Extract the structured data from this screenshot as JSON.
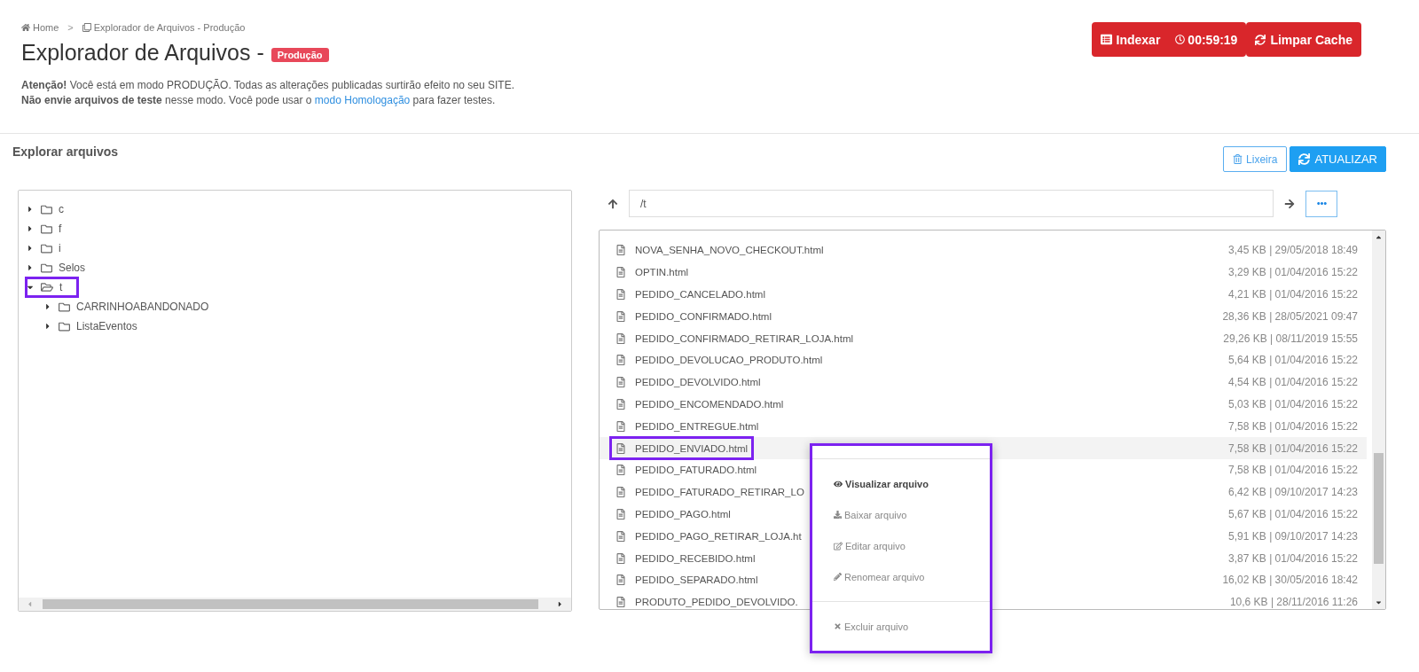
{
  "breadcrumb": {
    "items": [
      {
        "label": "Home",
        "kind": "home"
      },
      {
        "label": "Explorador de Arquivos - Produção",
        "kind": "page"
      }
    ],
    "separator": ">"
  },
  "title": "Explorador de Arquivos -",
  "badge": "Produção",
  "notice": [
    {
      "text": "**Atenção!** Você está em modo PRODUÇÃO. Todas as alterações publicadas surtirão efeito no seu SITE."
    },
    {
      "text": "**Não envie arquivos de teste** nesse modo. Você pode usar o ",
      "link": "modo Homologação",
      "after": " para fazer testes."
    }
  ],
  "header_actions": {
    "index": {
      "label": "Indexar",
      "timer": "00:59:19"
    },
    "clear_cache": "Limpar Cache"
  },
  "section_title": "Explorar arquivos",
  "toolbar": {
    "trash": "Lixeira",
    "refresh": "ATUALIZAR"
  },
  "tree": [
    {
      "label": "c",
      "expanded": false,
      "annotated": false
    },
    {
      "label": "f",
      "expanded": false,
      "annotated": false
    },
    {
      "label": "i",
      "expanded": false,
      "annotated": false
    },
    {
      "label": "Selos",
      "expanded": false,
      "annotated": false
    },
    {
      "label": "t",
      "expanded": true,
      "annotated": true,
      "children": [
        {
          "label": "CARRINHOABANDONADO",
          "expanded": false,
          "annotated": false
        },
        {
          "label": "ListaEventos",
          "expanded": false,
          "annotated": false
        }
      ]
    }
  ],
  "path": "/t",
  "files": [
    {
      "name": "NOVA_SENHA_NOVO_CHECKOUT.html",
      "meta": "3,45 KB | 29/05/2018 18:49",
      "selected": false,
      "annotated": false
    },
    {
      "name": "OPTIN.html",
      "meta": "3,29 KB | 01/04/2016 15:22",
      "selected": false,
      "annotated": false
    },
    {
      "name": "PEDIDO_CANCELADO.html",
      "meta": "4,21 KB | 01/04/2016 15:22",
      "selected": false,
      "annotated": false
    },
    {
      "name": "PEDIDO_CONFIRMADO.html",
      "meta": "28,36 KB | 28/05/2021 09:47",
      "selected": false,
      "annotated": false
    },
    {
      "name": "PEDIDO_CONFIRMADO_RETIRAR_LOJA.html",
      "meta": "29,26 KB | 08/11/2019 15:55",
      "selected": false,
      "annotated": false
    },
    {
      "name": "PEDIDO_DEVOLUCAO_PRODUTO.html",
      "meta": "5,64 KB | 01/04/2016 15:22",
      "selected": false,
      "annotated": false
    },
    {
      "name": "PEDIDO_DEVOLVIDO.html",
      "meta": "4,54 KB | 01/04/2016 15:22",
      "selected": false,
      "annotated": false
    },
    {
      "name": "PEDIDO_ENCOMENDADO.html",
      "meta": "5,03 KB | 01/04/2016 15:22",
      "selected": false,
      "annotated": false
    },
    {
      "name": "PEDIDO_ENTREGUE.html",
      "meta": "7,58 KB | 01/04/2016 15:22",
      "selected": false,
      "annotated": false
    },
    {
      "name": "PEDIDO_ENVIADO.html",
      "meta": "7,58 KB | 01/04/2016 15:22",
      "selected": true,
      "annotated": true
    },
    {
      "name": "PEDIDO_FATURADO.html",
      "meta": "7,58 KB | 01/04/2016 15:22",
      "selected": false,
      "annotated": false
    },
    {
      "name": "PEDIDO_FATURADO_RETIRAR_LO",
      "meta": "6,42 KB | 09/10/2017 14:23",
      "selected": false,
      "annotated": false
    },
    {
      "name": "PEDIDO_PAGO.html",
      "meta": "5,67 KB | 01/04/2016 15:22",
      "selected": false,
      "annotated": false
    },
    {
      "name": "PEDIDO_PAGO_RETIRAR_LOJA.ht",
      "meta": "5,91 KB | 09/10/2017 14:23",
      "selected": false,
      "annotated": false
    },
    {
      "name": "PEDIDO_RECEBIDO.html",
      "meta": "3,87 KB | 01/04/2016 15:22",
      "selected": false,
      "annotated": false
    },
    {
      "name": "PEDIDO_SEPARADO.html",
      "meta": "16,02 KB | 30/05/2016 18:42",
      "selected": false,
      "annotated": false
    },
    {
      "name": "PRODUTO_PEDIDO_DEVOLVIDO.",
      "meta": "10,6 KB | 28/11/2016 11:26",
      "selected": false,
      "annotated": false
    }
  ],
  "context_menu": {
    "annotated": true,
    "groups": [
      [
        {
          "label": "Visualizar arquivo",
          "kind": "view",
          "default": true
        },
        {
          "label": "Baixar arquivo",
          "kind": "download",
          "default": false
        },
        {
          "label": "Editar arquivo",
          "kind": "edit",
          "default": false
        },
        {
          "label": "Renomear arquivo",
          "kind": "rename",
          "default": false
        }
      ],
      [
        {
          "label": "Excluir arquivo",
          "kind": "delete",
          "default": false
        }
      ]
    ]
  }
}
